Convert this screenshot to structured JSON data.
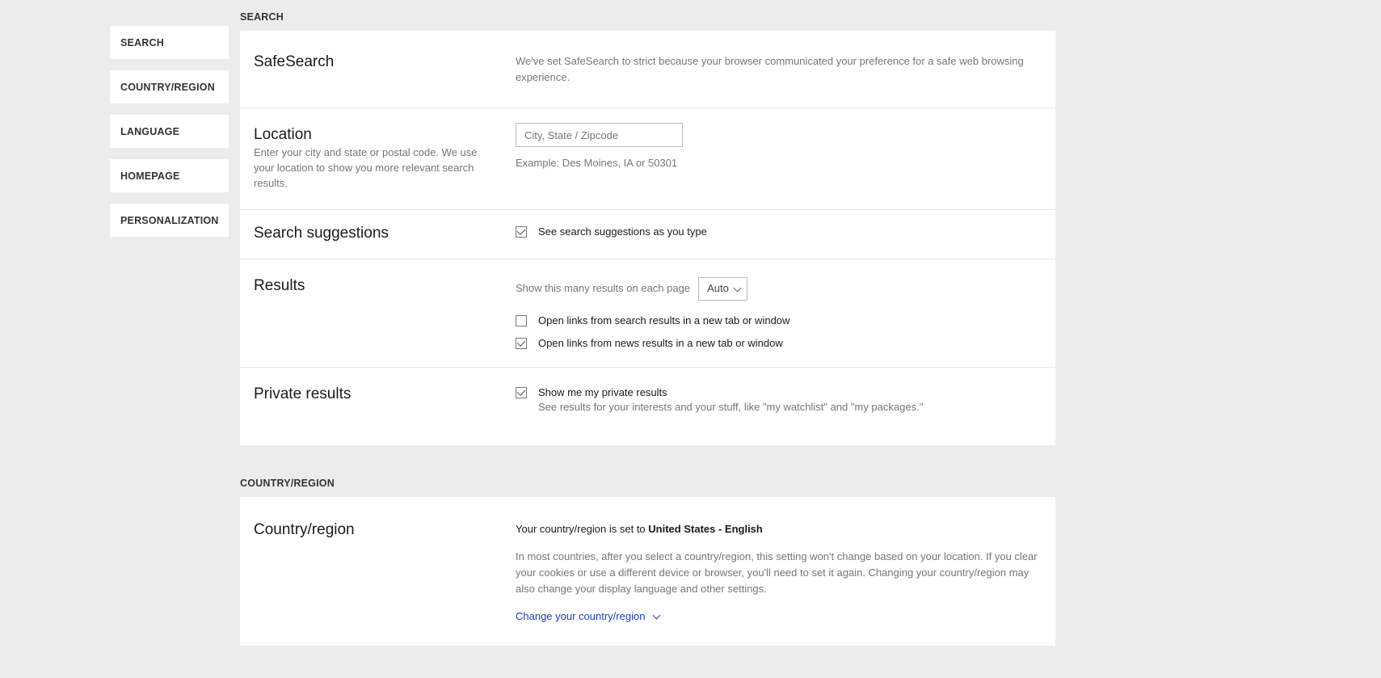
{
  "sidebar": {
    "items": [
      {
        "label": "SEARCH"
      },
      {
        "label": "COUNTRY/REGION"
      },
      {
        "label": "LANGUAGE"
      },
      {
        "label": "HOMEPAGE"
      },
      {
        "label": "PERSONALIZATION"
      }
    ]
  },
  "search_section": {
    "heading": "SEARCH",
    "safesearch": {
      "title": "SafeSearch",
      "body": "We've set SafeSearch to strict because your browser communicated your preference for a safe web browsing experience."
    },
    "location": {
      "title": "Location",
      "desc": "Enter your city and state or postal code. We use your location to show you more relevant search results.",
      "placeholder": "City, State / Zipcode",
      "value": "",
      "example": "Example: Des Moines, IA or 50301"
    },
    "suggestions": {
      "title": "Search suggestions",
      "checkbox": {
        "label": "See search suggestions as you type",
        "checked": true
      }
    },
    "results": {
      "title": "Results",
      "perpage_label": "Show this many results on each page",
      "perpage_select": "Auto",
      "open_search": {
        "label": "Open links from search results in a new tab or window",
        "checked": false
      },
      "open_news": {
        "label": "Open links from news results in a new tab or window",
        "checked": true
      }
    },
    "private": {
      "title": "Private results",
      "checkbox": {
        "label": "Show me my private results",
        "sub": "See results for your interests and your stuff, like \"my watchlist\" and \"my packages.\"",
        "checked": true
      }
    }
  },
  "country_section": {
    "heading": "COUNTRY/REGION",
    "row": {
      "title": "Country/region",
      "set_prefix": "Your country/region is set to ",
      "set_value": "United States - English",
      "desc": "In most countries, after you select a country/region, this setting won't change based on your location. If you clear your cookies or use a different device or browser, you'll need to set it again. Changing your country/region may also change your display language and other settings.",
      "link": "Change your country/region"
    }
  }
}
